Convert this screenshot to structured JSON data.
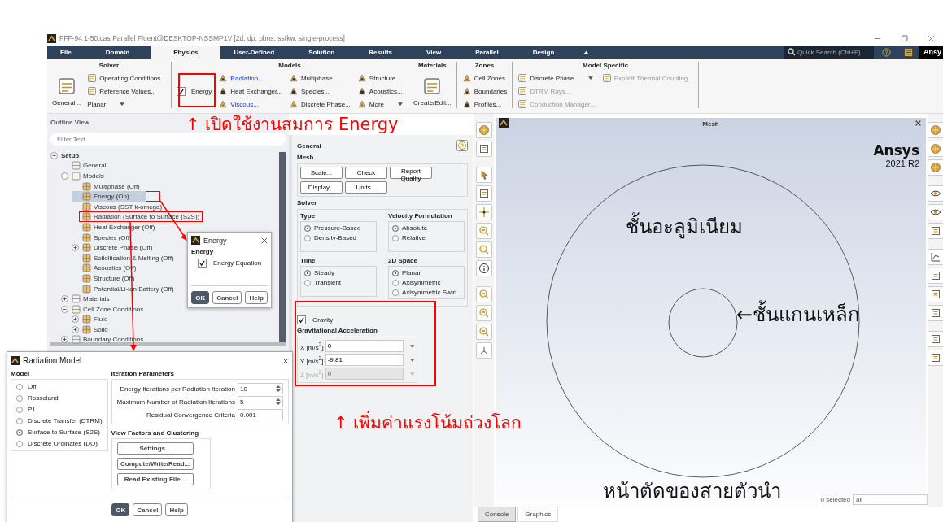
{
  "window": {
    "title": "FFF-94.1-50.cas Parallel Fluent@DESKTOP-NSSMP1V  [2d, dp, pbns, sstkw, single-process]"
  },
  "menu_tabs": [
    {
      "label": "File",
      "selected": false
    },
    {
      "label": "Domain",
      "selected": false
    },
    {
      "label": "Physics",
      "selected": true
    },
    {
      "label": "User-Defined",
      "selected": false
    },
    {
      "label": "Solution",
      "selected": false
    },
    {
      "label": "Results",
      "selected": false
    },
    {
      "label": "View",
      "selected": false
    },
    {
      "label": "Parallel",
      "selected": false
    },
    {
      "label": "Design",
      "selected": false
    }
  ],
  "quick_search": {
    "placeholder": "Quick Search (Ctrl+F)"
  },
  "brand": "Ansy",
  "ribbon": {
    "groups": [
      {
        "title": "Solver",
        "items": [
          {
            "label": "General...",
            "kind": "large"
          },
          {
            "label": "Operating Conditions...",
            "kind": "small"
          },
          {
            "label": "Reference Values...",
            "kind": "small"
          },
          {
            "label": "Planar",
            "kind": "dropdown"
          }
        ]
      },
      {
        "title": "Models",
        "items": [
          {
            "label": "Energy",
            "kind": "checkbox",
            "checked": true
          },
          {
            "label": "Radiation...",
            "kind": "small",
            "active": true
          },
          {
            "label": "Heat Exchanger...",
            "kind": "small",
            "active": false
          },
          {
            "label": "Viscous...",
            "kind": "small",
            "active": true
          },
          {
            "label": "Multiphase...",
            "kind": "small",
            "active": false
          },
          {
            "label": "Species...",
            "kind": "small",
            "active": false
          },
          {
            "label": "Discrete Phase...",
            "kind": "small",
            "active": false
          },
          {
            "label": "Structure...",
            "kind": "small",
            "active": false
          },
          {
            "label": "Acoustics...",
            "kind": "small",
            "active": false
          },
          {
            "label": "More",
            "kind": "dropdown",
            "active": false
          }
        ]
      },
      {
        "title": "Materials",
        "items": [
          {
            "label": "Create/Edit...",
            "kind": "large"
          }
        ]
      },
      {
        "title": "Zones",
        "items": [
          {
            "label": "Cell Zones",
            "kind": "small"
          },
          {
            "label": "Boundaries",
            "kind": "small"
          },
          {
            "label": "Profiles...",
            "kind": "small"
          }
        ]
      },
      {
        "title": "Model Specific",
        "items": [
          {
            "label": "Discrete Phase",
            "kind": "dropdown",
            "disabled": false
          },
          {
            "label": "DTRM Rays...",
            "kind": "small",
            "disabled": true
          },
          {
            "label": "Conduction Manager...",
            "kind": "small",
            "disabled": true
          },
          {
            "label": "Explicit Thermal Coupling...",
            "kind": "small",
            "disabled": true
          }
        ]
      }
    ]
  },
  "outline": {
    "title": "Outline View",
    "filter": {
      "placeholder": "Filter Text"
    },
    "tree": [
      {
        "label": "Setup",
        "expanded": true,
        "selected": false,
        "children": [
          {
            "label": "General",
            "selected": false
          },
          {
            "label": "Models",
            "expanded": true,
            "selected": false,
            "children": [
              {
                "label": "Multiphase (Off)",
                "selected": false
              },
              {
                "label": "Energy (On)",
                "selected": true
              },
              {
                "label": "Viscous (SST k-omega)",
                "selected": false
              },
              {
                "label": "Radiation (Surface to Surface (S2S))",
                "selected": false
              },
              {
                "label": "Heat Exchanger (Off)",
                "selected": false
              },
              {
                "label": "Species (Off)",
                "selected": false
              },
              {
                "label": "Discrete Phase (Off)",
                "expanded": false,
                "selected": false
              },
              {
                "label": "Solidification & Melting (Off)",
                "selected": false
              },
              {
                "label": "Acoustics (Off)",
                "selected": false
              },
              {
                "label": "Structure (Off)",
                "selected": false
              },
              {
                "label": "Potential/Li-ion Battery (Off)",
                "selected": false
              }
            ]
          },
          {
            "label": "Materials",
            "expanded": false,
            "selected": false
          },
          {
            "label": "Cell Zone Conditions",
            "expanded": true,
            "selected": false,
            "children": [
              {
                "label": "Fluid",
                "expanded": false,
                "selected": false
              },
              {
                "label": "Solid",
                "expanded": false,
                "selected": false
              }
            ]
          },
          {
            "label": "Boundary Conditions",
            "expanded": false,
            "selected": false
          }
        ]
      }
    ]
  },
  "general": {
    "title": "General",
    "mesh": {
      "title": "Mesh",
      "buttons": [
        "Scale...",
        "Check",
        "Report Quality",
        "Display...",
        "Units..."
      ]
    },
    "solver": {
      "title": "Solver",
      "groups": [
        {
          "title": "Type",
          "options": [
            {
              "label": "Pressure-Based",
              "selected": true
            },
            {
              "label": "Density-Based",
              "selected": false
            }
          ]
        },
        {
          "title": "Velocity Formulation",
          "options": [
            {
              "label": "Absolute",
              "selected": true
            },
            {
              "label": "Relative",
              "selected": false
            }
          ]
        },
        {
          "title": "Time",
          "options": [
            {
              "label": "Steady",
              "selected": true
            },
            {
              "label": "Transient",
              "selected": false
            }
          ]
        },
        {
          "title": "2D Space",
          "options": [
            {
              "label": "Planar",
              "selected": true
            },
            {
              "label": "Axisymmetric",
              "selected": false
            },
            {
              "label": "Axisymmetric Swirl",
              "selected": false
            }
          ]
        }
      ]
    },
    "gravity": {
      "label": "Gravity",
      "checked": true
    },
    "acceleration": {
      "title": "Gravitational Acceleration",
      "fields": [
        {
          "label": "X [m/s$^{2}$]",
          "value": "0",
          "disabled": false
        },
        {
          "label": "Y [m/s$^{2}$]",
          "value": "-9.81",
          "disabled": false
        },
        {
          "label": "Z [m/s$^{2}$]",
          "value": "0",
          "disabled": true
        }
      ]
    }
  },
  "graphics": {
    "title": "Mesh",
    "logo": "Ansys",
    "version": "2021 R2",
    "selection": "0 selected",
    "filter": "all",
    "labels": [
      "ชั้นอะลูมิเนียม",
      "←ชั้นแกนเหล็ก",
      "หน้าตัดของสายตัวนำ"
    ],
    "tabs": [
      {
        "label": "Console",
        "selected": true
      },
      {
        "label": "Graphics",
        "selected": false
      }
    ]
  },
  "energy_dialog": {
    "title": "Energy",
    "section": "Energy",
    "checkbox": {
      "label": "Energy Equation",
      "checked": true
    },
    "buttons": [
      "OK",
      "Cancel",
      "Help"
    ]
  },
  "radiation_dialog": {
    "title": "Radiation Model",
    "model_title": "Model",
    "models": [
      {
        "label": "Off",
        "selected": false
      },
      {
        "label": "Rosseland",
        "selected": false
      },
      {
        "label": "P1",
        "selected": false
      },
      {
        "label": "Discrete Transfer (DTRM)",
        "selected": false
      },
      {
        "label": "Surface to Surface (S2S)",
        "selected": true
      },
      {
        "label": "Discrete Ordinates (DO)",
        "selected": false
      }
    ],
    "params_title": "Iteration Parameters",
    "params": [
      {
        "label": "Energy Iterations per Radiation Iteration",
        "value": "10",
        "kind": "spinner"
      },
      {
        "label": "Maximum Number of Radiation Iterations",
        "value": "5",
        "kind": "spinner"
      },
      {
        "label": "Residual Convergence Criteria",
        "value": "0.001",
        "kind": "text"
      }
    ],
    "view_title": "View Factors and Clustering",
    "view_buttons": [
      "Settings...",
      "Compute/Write/Read...",
      "Read Existing File..."
    ],
    "buttons": [
      "OK",
      "Cancel",
      "Help"
    ]
  },
  "notes": [
    {
      "text": "↑ เปิดใช้งานสมการ Energy",
      "color": "#ff0000"
    },
    {
      "text": "↑ เพิ่มค่าแรงโน้มถ่วงโลก",
      "color": "#ff0000"
    }
  ]
}
